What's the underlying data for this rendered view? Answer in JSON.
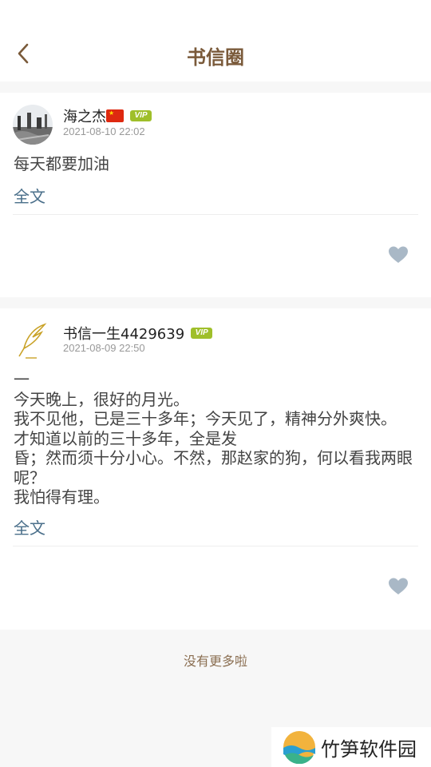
{
  "header": {
    "title": "书信圈",
    "back_icon": "chevron-left-icon"
  },
  "posts": [
    {
      "username": "海之杰",
      "flag": "china-flag",
      "badge": "VIP",
      "date": "2021-08-10 22:02",
      "content": "每天都要加油",
      "fulltext_label": "全文",
      "like_icon": "heart-icon"
    },
    {
      "username": "书信一生4429639",
      "badge": "VIP",
      "date": "2021-08-09 22:50",
      "content": "一\n今天晚上，很好的月光。\n我不见他，已是三十多年；今天见了，精神分外爽快。\n才知道以前的三十多年，全是发\n昏；然而须十分小心。不然，那赵家的狗，何以看我两眼呢？\n我怕得有理。",
      "fulltext_label": "全文",
      "like_icon": "heart-icon"
    }
  ],
  "footer": {
    "no_more": "没有更多啦"
  },
  "watermark": {
    "text": "竹笋软件园"
  },
  "colors": {
    "title": "#7a5a3a",
    "link": "#4a6f8a",
    "vip": "#9fbf2a",
    "heart": "#a9b8c6"
  }
}
